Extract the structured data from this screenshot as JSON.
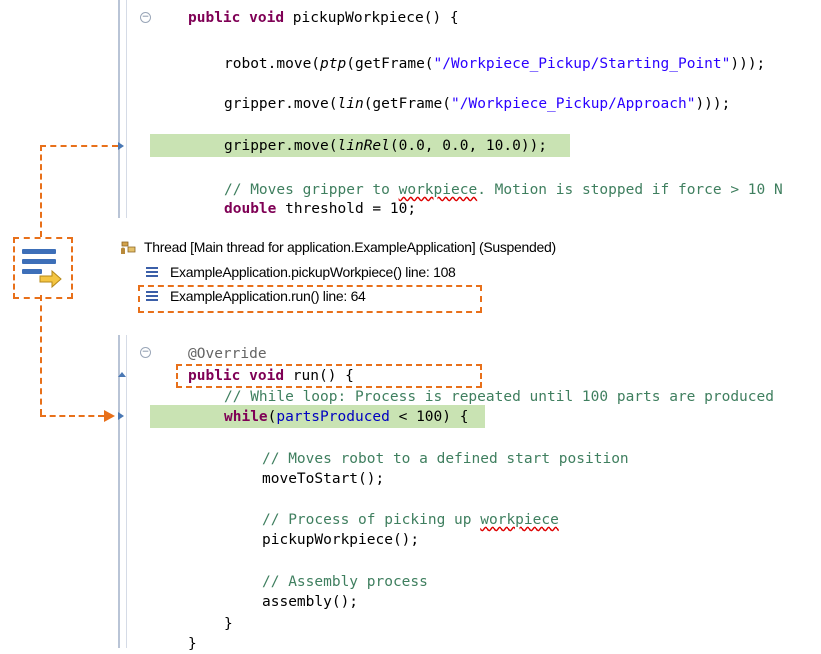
{
  "top_code": {
    "line1": {
      "kw1": "public",
      "kw2": "void",
      "rest": " pickupWorkpiece() {"
    },
    "line2": {
      "a": "robot.move(",
      "ptp": "ptp",
      "b": "(getFrame(",
      "s": "\"/Workpiece_Pickup/Starting_Point\"",
      "c": ")));"
    },
    "line3": {
      "a": "gripper.move(",
      "lin": "lin",
      "b": "(getFrame(",
      "s": "\"/Workpiece_Pickup/Approach\"",
      "c": ")));"
    },
    "line4": {
      "a": "gripper.move(",
      "linrel": "linRel",
      "b": "(0.0, 0.0, 10.0));"
    },
    "line5": {
      "a": "// Moves gripper to ",
      "w": "workpiece",
      "b": ". Motion is stopped if force > 10 N"
    },
    "line6": {
      "kw": "double",
      "rest": " threshold = 10;"
    }
  },
  "debug": {
    "thread_label": "Thread [Main thread for application.ExampleApplication] (Suspended)",
    "frames": [
      {
        "label": "ExampleApplication.pickupWorkpiece() line: 108"
      },
      {
        "label": "ExampleApplication.run() line: 64"
      }
    ]
  },
  "bottom_code": {
    "annotation": "@Override",
    "line1": {
      "kw1": "public",
      "kw2": "void",
      "rest": " run() {"
    },
    "line2": "// While loop: Process is repeated until 100 parts are produced",
    "line3": {
      "kw": "while",
      "a": "(",
      "f": "partsProduced",
      "b": " < 100) {"
    },
    "line4": "// Moves robot to a defined start position",
    "line5": "moveToStart();",
    "line6": {
      "a": "// Process of picking up ",
      "w": "workpiece"
    },
    "line7": "pickupWorkpiece();",
    "line8": "// Assembly process",
    "line9": "assembly();",
    "line10": "}",
    "line11": "}"
  },
  "colors": {
    "highlight": "#c9e3b3",
    "callout": "#e8701a",
    "keyword": "#7f0055",
    "string": "#2a00ff",
    "comment": "#3f7f5f",
    "field": "#0000c0"
  },
  "icons": [
    "fold-collapse-icon",
    "instruction-pointer-icon",
    "thread-icon",
    "stack-frame-icon",
    "drop-to-frame-icon"
  ]
}
